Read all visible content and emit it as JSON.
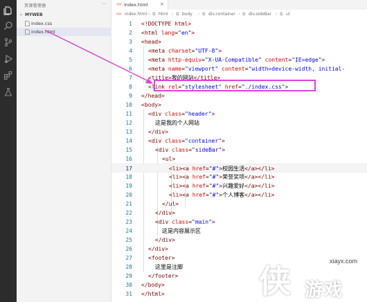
{
  "sidebar": {
    "title": "资源管理器",
    "more": "···",
    "folder": {
      "name": "MYWEB",
      "chevron": "⌄"
    },
    "files": [
      {
        "name": "index.css",
        "icon": "css-file-icon",
        "active": false
      },
      {
        "name": "index.html",
        "icon": "html-file-icon",
        "active": true
      }
    ]
  },
  "tab": {
    "icon": "<>",
    "label": "index.html",
    "close": "×"
  },
  "breadcrumb": {
    "items": [
      "index.html",
      "html",
      "body",
      "div.container",
      "div.sideBar",
      "ul"
    ]
  },
  "editor": {
    "current_line": 17,
    "lines": [
      {
        "n": "1"
      },
      {
        "n": "2"
      },
      {
        "n": "3"
      },
      {
        "n": "4"
      },
      {
        "n": "5"
      },
      {
        "n": "6"
      },
      {
        "n": "7"
      },
      {
        "n": "8"
      },
      {
        "n": "9"
      },
      {
        "n": "10"
      },
      {
        "n": "11"
      },
      {
        "n": "12"
      },
      {
        "n": "13"
      },
      {
        "n": "14"
      },
      {
        "n": "15"
      },
      {
        "n": "16"
      },
      {
        "n": "17"
      },
      {
        "n": "18"
      },
      {
        "n": "19"
      },
      {
        "n": "20"
      },
      {
        "n": "21"
      },
      {
        "n": "22"
      },
      {
        "n": "23"
      },
      {
        "n": "24"
      },
      {
        "n": "25"
      },
      {
        "n": "26"
      },
      {
        "n": "27"
      },
      {
        "n": "28"
      },
      {
        "n": "29"
      },
      {
        "n": "30"
      },
      {
        "n": "31"
      }
    ],
    "code": {
      "l1": [
        "<!DOCTYPE html>"
      ],
      "l2": [
        "<html",
        "lang",
        "=",
        "\"en\"",
        ">"
      ],
      "l3": [
        "<head>"
      ],
      "l4": [
        "<meta",
        "charset",
        "=",
        "\"UTF-8\"",
        ">"
      ],
      "l5": [
        "<meta",
        "http-equiv",
        "=",
        "\"X-UA-Compatible\"",
        "content",
        "=",
        "\"IE=edge\"",
        ">"
      ],
      "l6": [
        "<meta",
        "name",
        "=",
        "\"viewport\"",
        "content",
        "=",
        "\"width=device-width, initial-"
      ],
      "l7": [
        "<title>",
        "我的网站",
        "</title>"
      ],
      "l8": [
        "<link",
        "rel",
        "=",
        "\"stylesheet\"",
        "href",
        "=",
        "\"./index.css\"",
        ">"
      ],
      "l9": [
        "</head>"
      ],
      "l10": [
        "<body>"
      ],
      "l11": [
        "<div",
        "class",
        "=",
        "\"header\"",
        ">"
      ],
      "l12": [
        "这是我的个人网站"
      ],
      "l13": [
        "</div>"
      ],
      "l14": [
        "<div",
        "class",
        "=",
        "\"container\"",
        ">"
      ],
      "l15": [
        "<div",
        "class",
        "=",
        "\"sideBar\"",
        ">"
      ],
      "l16": [
        "<ul>"
      ],
      "l17": [
        "<li>",
        "<a",
        "href",
        "=",
        "\"#\"",
        ">",
        "校园生活",
        "</a>",
        "</li>"
      ],
      "l18": [
        "<li>",
        "<a",
        "href",
        "=",
        "\"#\"",
        ">",
        "荣誉奖项",
        "</a>",
        "</li>"
      ],
      "l19": [
        "<li>",
        "<a",
        "href",
        "=",
        "\"#\"",
        ">",
        "兴趣爱好",
        "</a>",
        "</li>"
      ],
      "l20": [
        "<li>",
        "<a",
        "href",
        "=",
        "\"#\"",
        ">",
        "个人博客",
        "</a>",
        "</li>"
      ],
      "l21": [
        "</ul>"
      ],
      "l22": [
        "</div>"
      ],
      "l23": [
        "<div",
        "class",
        "=",
        "\"main\"",
        ">"
      ],
      "l24": [
        "这是内容展示区"
      ],
      "l25": [
        "</div>"
      ],
      "l26": [
        "</div>"
      ],
      "l27": [
        "<footer>"
      ],
      "l28": [
        "这里是注脚"
      ],
      "l29": [
        "</footer>"
      ],
      "l30": [
        "</body>"
      ],
      "l31": [
        "</html>"
      ]
    }
  },
  "annotation": {
    "color": "#e040e0"
  },
  "watermark": {
    "url": "xiayx.com",
    "big": "侠",
    "small": "游戏"
  },
  "colors": {
    "activity_bar": "#2c2c2c",
    "sidebar_bg": "#f3f3f3",
    "tag": "#800000",
    "attr": "#e50000",
    "value": "#0000ff",
    "line_number": "#237893"
  }
}
